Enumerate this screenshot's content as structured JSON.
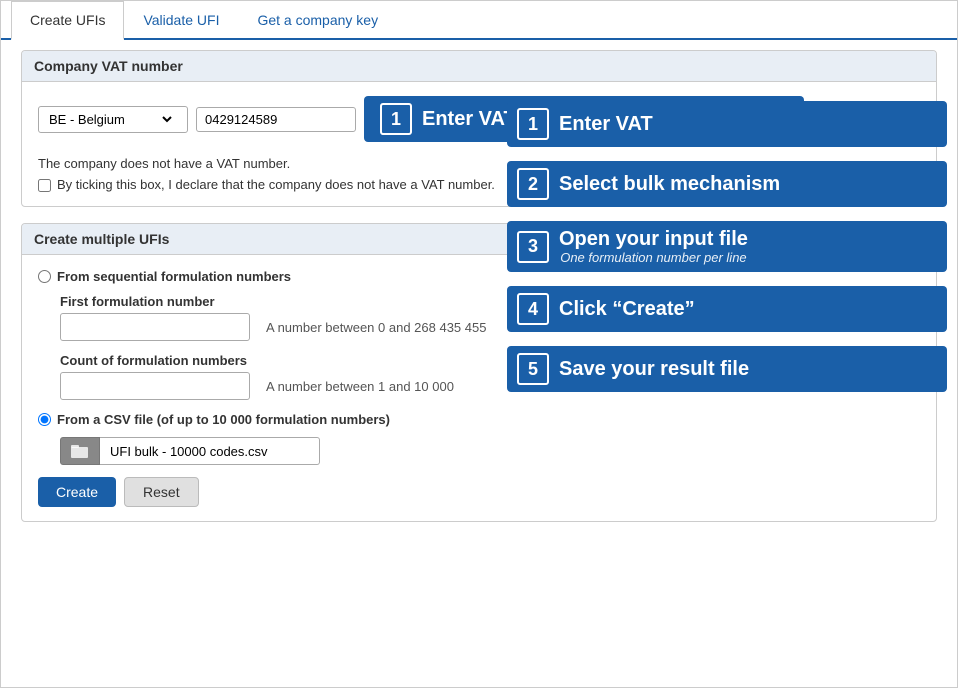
{
  "tabs": [
    {
      "label": "Create UFIs",
      "active": true
    },
    {
      "label": "Validate UFI",
      "active": false
    },
    {
      "label": "Get a company key",
      "active": false
    }
  ],
  "vat_section": {
    "title": "Company VAT number",
    "country_default": "BE - Belgium",
    "vat_value": "0429124589",
    "enter_vat_btn": "Enter VAT",
    "no_vat_text": "The company does not have a VAT number.",
    "no_vat_checkbox_label": "By ticking this box, I declare that the company does not have a VAT number.",
    "step1_badge": "1"
  },
  "multiple_ufis_section": {
    "title": "Create multiple UFIs",
    "radio1_label": "From sequential formulation numbers",
    "first_formulation_label": "First formulation number",
    "first_formulation_hint": "A number between 0 and 268 435 455",
    "count_label": "Count of formulation numbers",
    "count_hint": "A number between 1 and 10 000",
    "radio2_label": "From a CSV file (of up to 10 000 formulation numbers)",
    "file_name": "UFI bulk - 10000 codes.csv",
    "btn_create": "Create",
    "btn_reset": "Reset"
  },
  "steps": [
    {
      "badge": "1",
      "label": "Enter VAT",
      "sub": ""
    },
    {
      "badge": "2",
      "label": "Select bulk mechanism",
      "sub": ""
    },
    {
      "badge": "3",
      "label": "Open your input file",
      "sub": "One formulation number per line"
    },
    {
      "badge": "4",
      "label": "Click “Create”",
      "sub": ""
    },
    {
      "badge": "5",
      "label": "Save your result file",
      "sub": ""
    }
  ]
}
